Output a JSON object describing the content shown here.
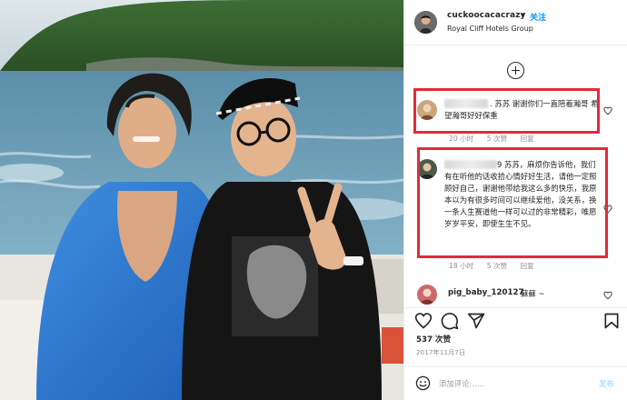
{
  "post": {
    "username": "cuckoocacacrazy",
    "separator": "•",
    "follow_label": "关注",
    "location": "Royal Cliff Hotels Group"
  },
  "comments": [
    {
      "text": ". 苏苏 谢谢你们一直陪着瀚哥 希望瀚哥好好保重",
      "time": "20 小时",
      "likes": "5 次赞",
      "reply": "回复"
    },
    {
      "text": "9 苏苏，麻烦你告诉他，我们有在听他的话收拾心情好好生活，请他一定照顾好自己，谢谢他带给我这么多的快乐，我原本以为有很多时间可以继续爱他，没关系，换一条人生赛道他一样可以过的非常精彩，唯愿岁岁平安，即使生生不见。",
      "time": "18 小时",
      "likes": "5 次赞",
      "reply": "回复"
    }
  ],
  "last_comment": {
    "username": "pig_baby_120127",
    "text": "蘇蘇 ~"
  },
  "icons": {
    "heart": "heart-icon",
    "comment": "comment-icon",
    "share": "share-icon",
    "save": "bookmark-icon",
    "emoji": "emoji-icon",
    "more": "add-circle-icon"
  },
  "likes_count": "537 次赞",
  "date": "2017年11月7日",
  "composer": {
    "placeholder": "添加评论……",
    "post_label": "发布"
  },
  "colors": {
    "accent": "#0095f6",
    "highlight_box": "#e32b35",
    "muted": "#8e8e8e"
  }
}
